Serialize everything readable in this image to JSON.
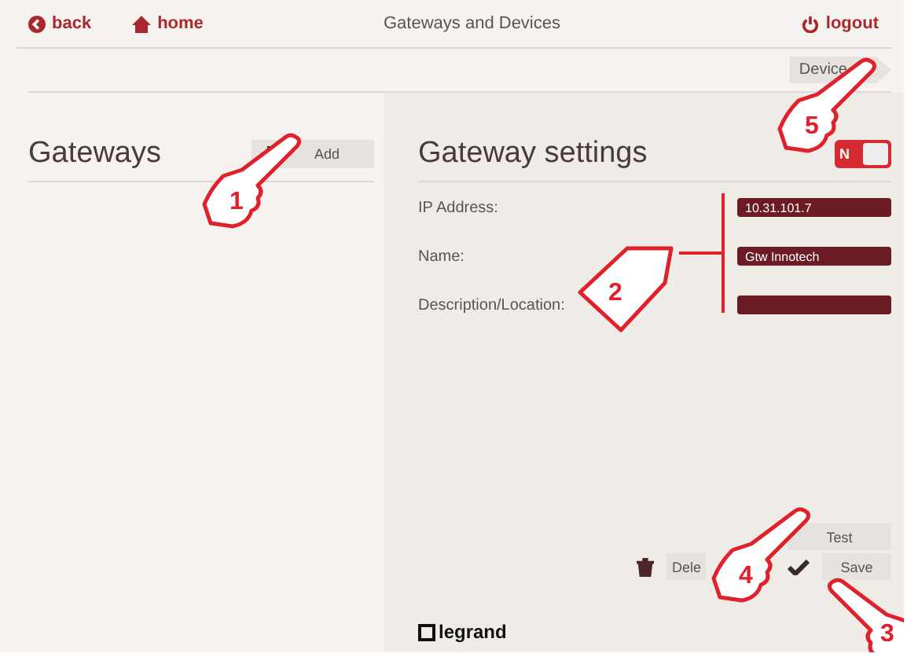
{
  "top_bar": {
    "back": "back",
    "home": "home",
    "title": "Gateways and Devices",
    "logout": "logout"
  },
  "breadcrumb": {
    "label": "Device",
    "selected": false
  },
  "gateways_panel": {
    "title": "Gateways",
    "add_button": "Add"
  },
  "settings_panel": {
    "title": "Gateway settings",
    "toggle": {
      "label": "N",
      "on": true
    },
    "fields": [
      {
        "label": "IP Address:",
        "value": "10.31.101.7"
      },
      {
        "label": "Name:",
        "value": "Gtw Innotech"
      },
      {
        "label": "Description/Location:"
      }
    ],
    "test_button": "Test",
    "delete_button": "Dele",
    "save_button": "Save"
  },
  "logo": "legrand",
  "callouts": [
    {
      "number": "1",
      "kind": "hand"
    },
    {
      "number": "2",
      "kind": "tag"
    },
    {
      "number": "3",
      "kind": "hand"
    },
    {
      "number": "4",
      "kind": "hand"
    },
    {
      "number": "5",
      "kind": "hand"
    }
  ]
}
